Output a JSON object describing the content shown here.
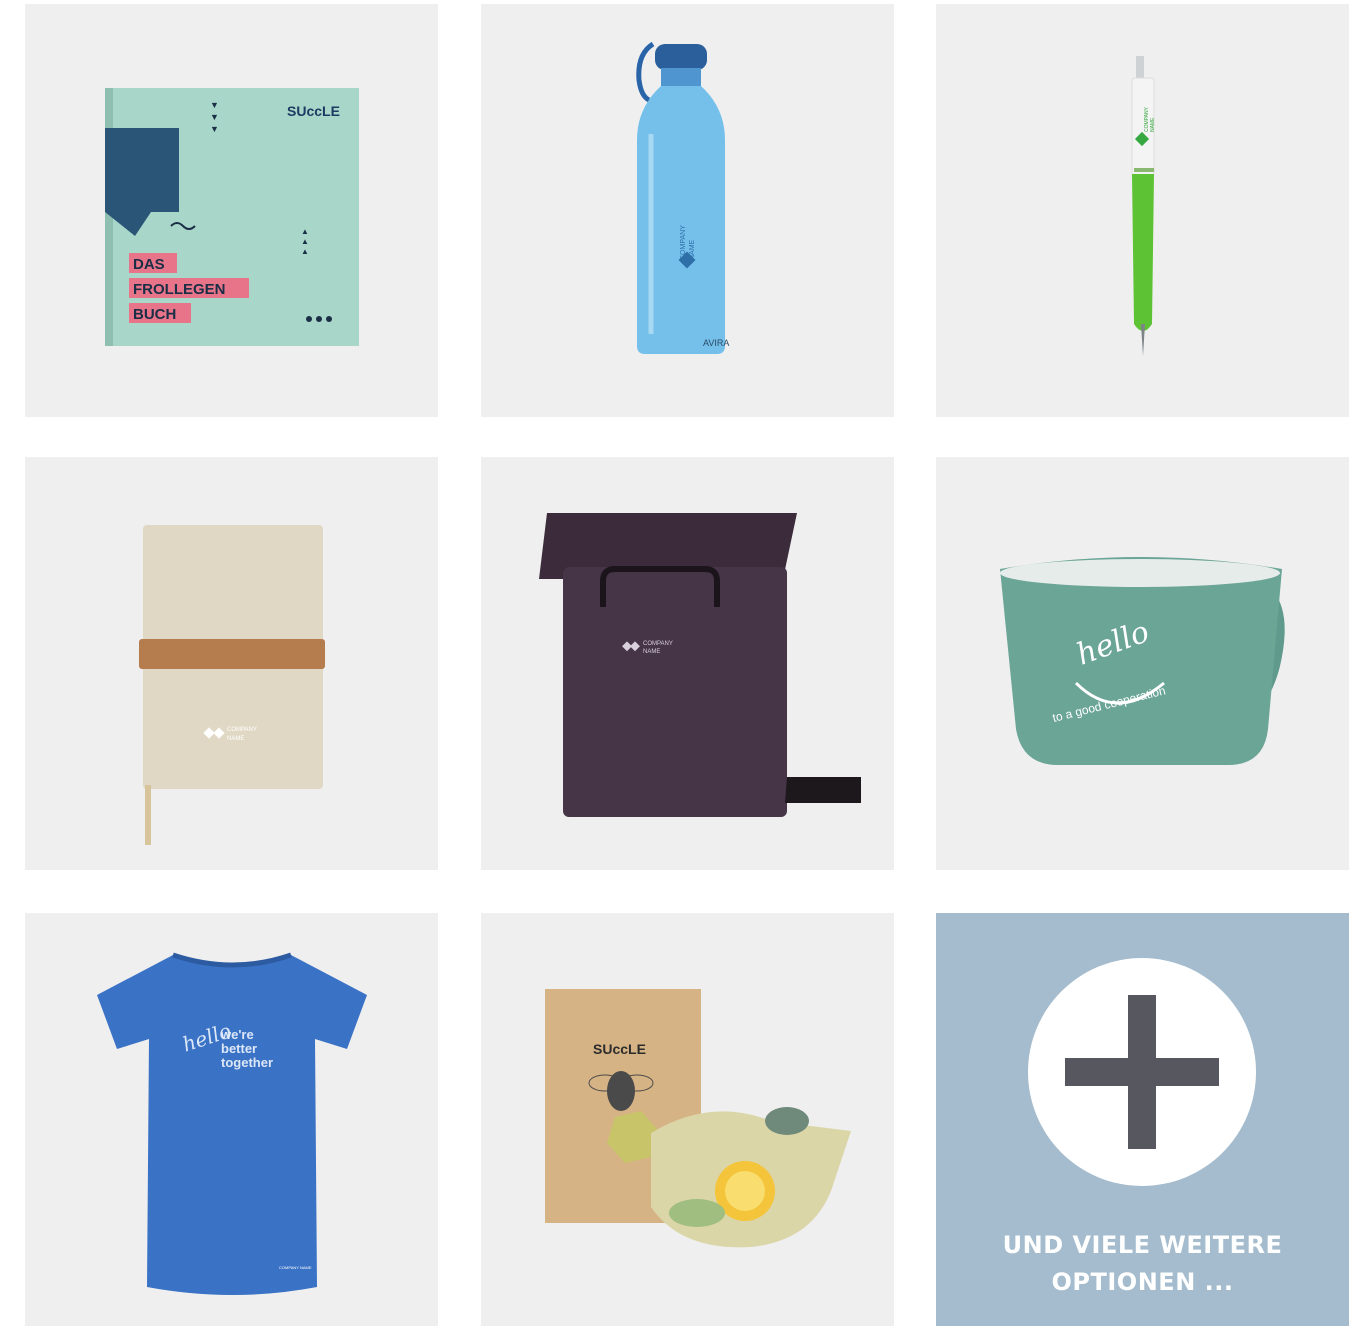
{
  "products": [
    {
      "id": "book",
      "logo": "SUccLE",
      "title_lines": [
        "DAS",
        "FROLLEGEN",
        "BUCH"
      ]
    },
    {
      "id": "bottle",
      "print": [
        "COMPANY",
        "NAME"
      ],
      "brand": "AVIRA"
    },
    {
      "id": "pen",
      "print": [
        "COMPANY",
        "NAME"
      ]
    },
    {
      "id": "notebook",
      "print": [
        "COMPANY",
        "NAME"
      ]
    },
    {
      "id": "backpack",
      "print": [
        "COMPANY",
        "NAME"
      ]
    },
    {
      "id": "mug",
      "hello": "hello",
      "slogan": "to a good cooperation"
    },
    {
      "id": "tshirt",
      "hello": "hello",
      "slogan_lines": [
        "we're",
        "better",
        "together"
      ],
      "print": "COMPANY NAME"
    },
    {
      "id": "beeswax-wrap",
      "logo": "SUccLE"
    }
  ],
  "more_tile": {
    "icon": "plus-icon",
    "label_line1": "UND VIELE WEITERE",
    "label_line2": "OPTIONEN ..."
  },
  "colors": {
    "tile_bg": "#efefef",
    "more_bg": "#a4bccd",
    "plus": "#57575f"
  }
}
